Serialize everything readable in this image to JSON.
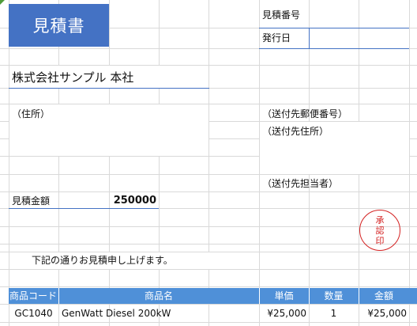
{
  "quote": {
    "title": "見積書",
    "number_label": "見積番号",
    "issue_date_label": "発行日",
    "company_name": "株式会社サンプル 本社",
    "address_label": "（住所）",
    "dest_postal_label": "（送付先郵便番号）",
    "dest_address_label": "（送付先住所）",
    "dest_contact_label": "（送付先担当者）",
    "amount_label": "見積金額",
    "amount_value": "250000",
    "message": "下記の通りお見積申し上げます。"
  },
  "stamp": {
    "chars": [
      "承",
      "認",
      "印"
    ],
    "color": "#d32020"
  },
  "table": {
    "headers": [
      "商品コード",
      "商品名",
      "単価",
      "数量",
      "金額"
    ],
    "rows": [
      [
        "GC1040",
        "GenWatt Diesel 200kW",
        "¥25,000",
        "1",
        "¥25,000"
      ]
    ]
  },
  "colors": {
    "title_bg": "#4472c4",
    "table_header_bg": "#4f90d8",
    "grid": "#d9d9d9"
  }
}
